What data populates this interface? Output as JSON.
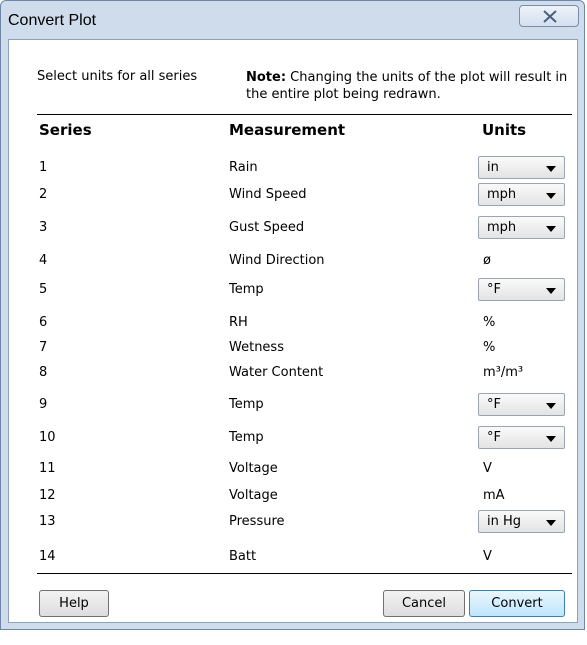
{
  "window": {
    "title": "Convert Plot"
  },
  "instructions": {
    "select_units": "Select units for all series",
    "note_label": "Note:",
    "note_text": " Changing the units of the plot will result in the entire plot being redrawn."
  },
  "table": {
    "headers": {
      "series": "Series",
      "measurement": "Measurement",
      "units": "Units"
    },
    "rows": [
      {
        "series": "1",
        "measurement": "Rain",
        "units": "in",
        "dropdown": true
      },
      {
        "series": "2",
        "measurement": "Wind Speed",
        "units": "mph",
        "dropdown": true
      },
      {
        "series": "3",
        "measurement": "Gust Speed",
        "units": "mph",
        "dropdown": true
      },
      {
        "series": "4",
        "measurement": "Wind Direction",
        "units": "ø",
        "dropdown": false
      },
      {
        "series": "5",
        "measurement": "Temp",
        "units": "°F",
        "dropdown": true
      },
      {
        "series": "6",
        "measurement": "RH",
        "units": "%",
        "dropdown": false
      },
      {
        "series": "7",
        "measurement": "Wetness",
        "units": "%",
        "dropdown": false
      },
      {
        "series": "8",
        "measurement": "Water Content",
        "units": "m³/m³",
        "dropdown": false
      },
      {
        "series": "9",
        "measurement": "Temp",
        "units": "°F",
        "dropdown": true
      },
      {
        "series": "10",
        "measurement": "Temp",
        "units": "°F",
        "dropdown": true
      },
      {
        "series": "11",
        "measurement": "Voltage",
        "units": "V",
        "dropdown": false
      },
      {
        "series": "12",
        "measurement": "Voltage",
        "units": "mA",
        "dropdown": false
      },
      {
        "series": "13",
        "measurement": "Pressure",
        "units": "in Hg",
        "dropdown": true
      },
      {
        "series": "14",
        "measurement": "Batt",
        "units": "V",
        "dropdown": false
      }
    ]
  },
  "buttons": {
    "help": "Help",
    "cancel": "Cancel",
    "convert": "Convert"
  }
}
